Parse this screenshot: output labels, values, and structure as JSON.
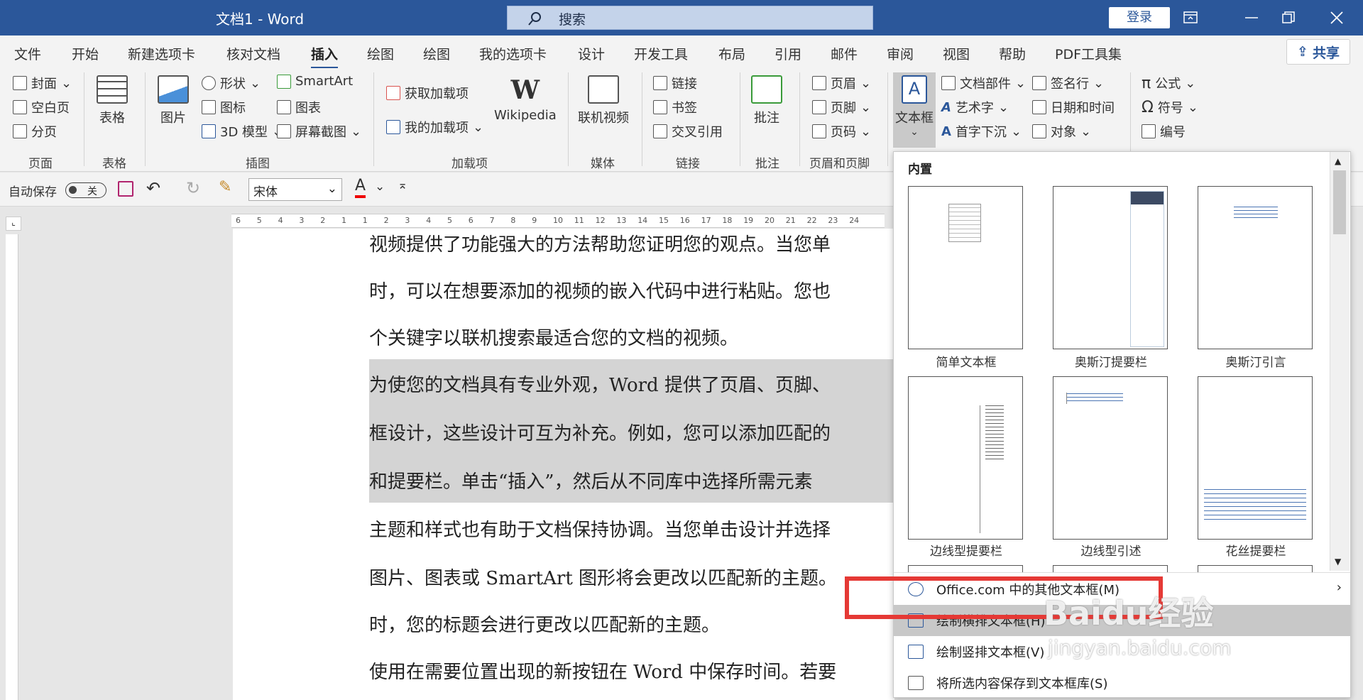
{
  "window": {
    "title": "文档1 - Word",
    "search_placeholder": "搜索",
    "login": "登录"
  },
  "tabs": [
    "文件",
    "开始",
    "新建选项卡",
    "核对文档",
    "插入",
    "绘图",
    "绘图",
    "我的选项卡",
    "设计",
    "开发工具",
    "布局",
    "引用",
    "邮件",
    "审阅",
    "视图",
    "帮助",
    "PDF工具集"
  ],
  "active_tab": "插入",
  "share": "共享",
  "ribbon": {
    "pages": {
      "cover": "封面",
      "blank": "空白页",
      "break": "分页",
      "group": "页面"
    },
    "table": {
      "label": "表格",
      "group": "表格"
    },
    "illustrations": {
      "picture": "图片",
      "shapes": "形状",
      "icons": "图标",
      "model3d": "3D 模型",
      "smartart": "SmartArt",
      "chart": "图表",
      "screenshot": "屏幕截图",
      "group": "插图"
    },
    "addins": {
      "get": "获取加载项",
      "mine": "我的加载项",
      "wikipedia": "Wikipedia",
      "group": "加载项"
    },
    "media": {
      "video": "联机视频",
      "group": "媒体"
    },
    "links": {
      "link": "链接",
      "bookmark": "书签",
      "crossref": "交叉引用",
      "group": "链接"
    },
    "comments": {
      "comment": "批注",
      "group": "批注"
    },
    "headerfooter": {
      "header": "页眉",
      "footer": "页脚",
      "pagenum": "页码",
      "group": "页眉和页脚"
    },
    "text": {
      "textbox": "文本框",
      "parts": "文档部件",
      "wordart": "艺术字",
      "dropcap": "首字下沉",
      "sigline": "签名行",
      "datetime": "日期和时间",
      "object": "对象"
    },
    "symbols": {
      "equation": "公式",
      "symbol": "符号",
      "number": "编号"
    }
  },
  "qat": {
    "autosave": "自动保存",
    "toggle": "关",
    "font": "宋体",
    "font_color_letter": "A"
  },
  "document": {
    "lines": [
      "视频提供了功能强大的方法帮助您证明您的观点。当您单",
      "时，可以在想要添加的视频的嵌入代码中进行粘贴。您也",
      "个关键字以联机搜索最适合您的文档的视频。",
      "为使您的文档具有专业外观，Word 提供了页眉、页脚、",
      "框设计，这些设计可互为补充。例如，您可以添加匹配的",
      "和提要栏。单击“插入”，然后从不同库中选择所需元素",
      "主题和样式也有助于文档保持协调。当您单击设计并选择",
      "图片、图表或 SmartArt 图形将会更改以匹配新的主题。",
      "时，您的标题会进行更改以匹配新的主题。",
      "使用在需要位置出现的新按钮在 Word 中保存时间。若要"
    ]
  },
  "ruler_numbers": [
    "6",
    "5",
    "4",
    "3",
    "2",
    "1",
    "1",
    "2",
    "3",
    "4",
    "5",
    "6",
    "7",
    "8",
    "9",
    "10",
    "11",
    "12",
    "13",
    "14",
    "15",
    "16",
    "17",
    "18",
    "19",
    "20",
    "21",
    "22",
    "23",
    "24"
  ],
  "panel": {
    "header": "内置",
    "items": [
      "简单文本框",
      "奥斯汀提要栏",
      "奥斯汀引言",
      "边线型提要栏",
      "边线型引述",
      "花丝提要栏"
    ],
    "menu": [
      "Office.com 中的其他文本框(M)",
      "绘制横排文本框(H)",
      "绘制竖排文本框(V)",
      "将所选内容保存到文本框库(S)"
    ]
  },
  "watermark": {
    "brand": "Baidu经验",
    "url": "jingyan.baidu.com"
  },
  "colors": {
    "titlebar": "#2b579a",
    "highlight": "#e53935"
  }
}
